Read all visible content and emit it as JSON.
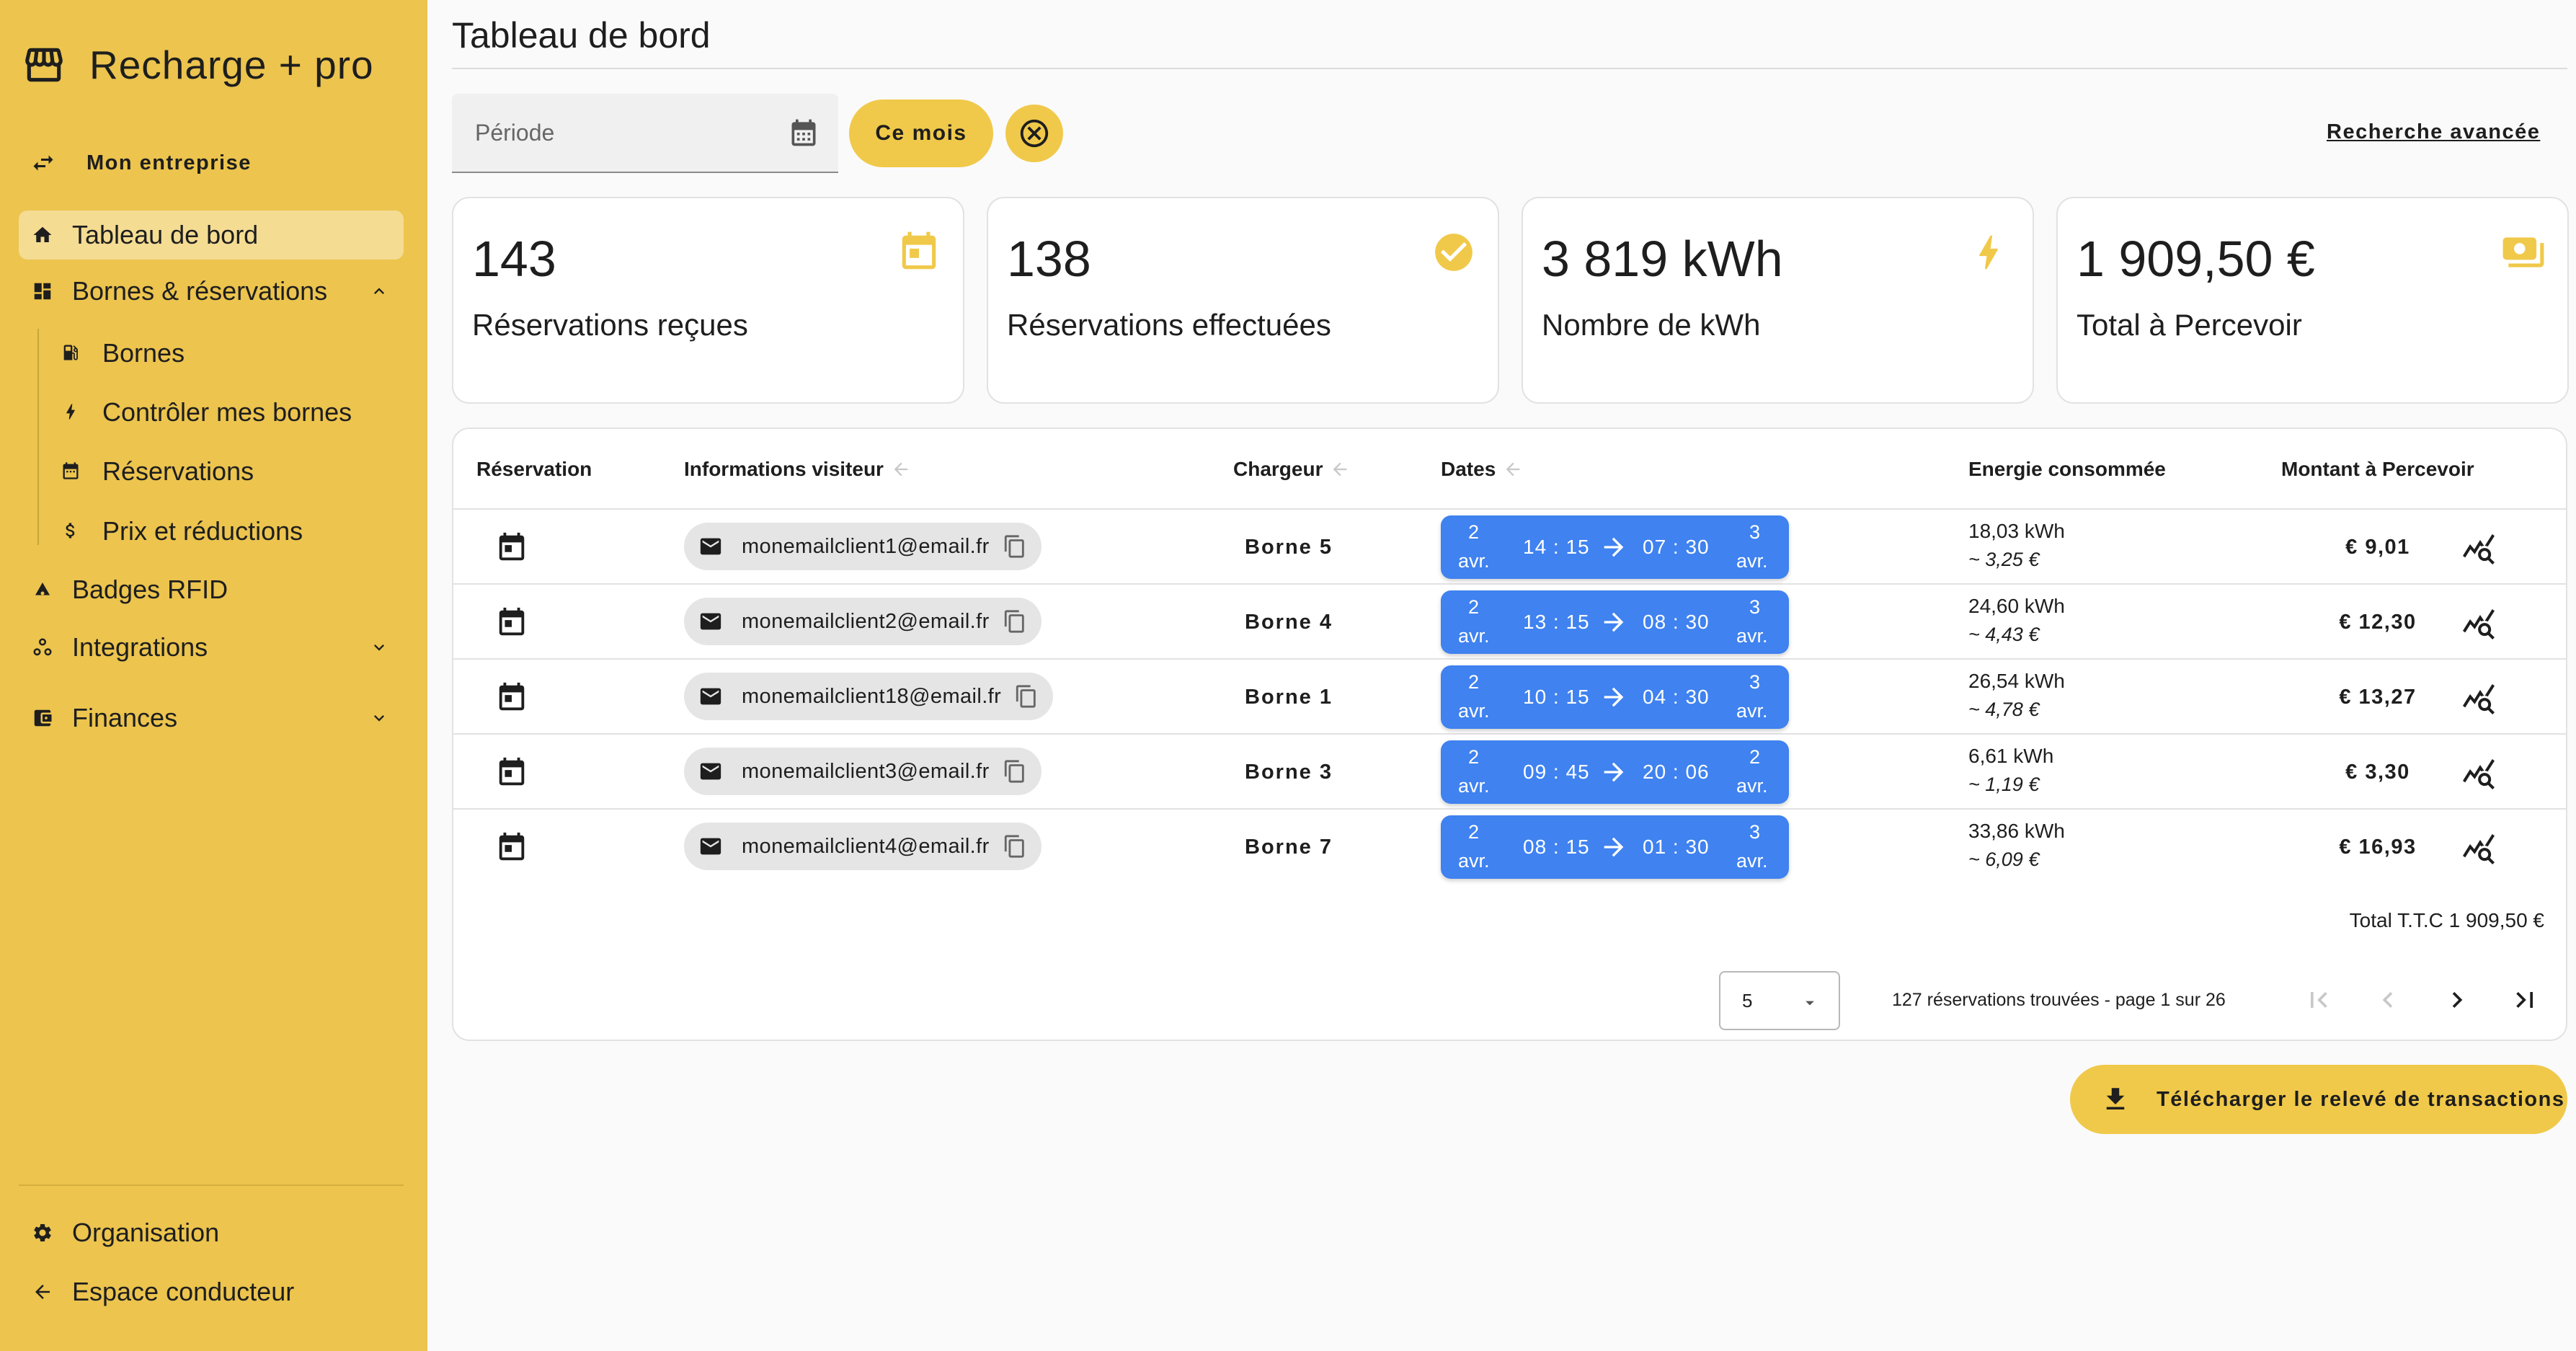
{
  "app": {
    "title": "Recharge + pro"
  },
  "sidebar": {
    "company": "Mon entreprise",
    "items": [
      {
        "label": "Tableau de bord",
        "icon": "home-icon",
        "active": true
      },
      {
        "label": "Bornes & réservations",
        "icon": "dashboard-icon",
        "expanded": true
      },
      {
        "label": "Bornes",
        "icon": "ev-station-icon"
      },
      {
        "label": "Contrôler mes bornes",
        "icon": "bolt-icon"
      },
      {
        "label": "Réservations",
        "icon": "calendar-icon"
      },
      {
        "label": "Prix et réductions",
        "icon": "price-icon"
      },
      {
        "label": "Badges RFID",
        "icon": "rfid-icon"
      },
      {
        "label": "Integrations",
        "icon": "integrations-icon",
        "expanded": false
      },
      {
        "label": "Finances",
        "icon": "wallet-icon",
        "expanded": false
      }
    ],
    "bottom": [
      {
        "label": "Organisation",
        "icon": "gear-icon"
      },
      {
        "label": "Espace conducteur",
        "icon": "arrow-left-icon"
      }
    ]
  },
  "header": {
    "title": "Tableau de bord"
  },
  "filters": {
    "period_placeholder": "Période",
    "month_button": "Ce mois",
    "advanced_search": "Recherche avancée"
  },
  "stats": [
    {
      "value": "143",
      "label": "Réservations reçues",
      "icon": "calendar-today-icon"
    },
    {
      "value": "138",
      "label": "Réservations effectuées",
      "icon": "check-circle-icon"
    },
    {
      "value": "3 819 kWh",
      "label": "Nombre de kWh",
      "icon": "bolt-icon"
    },
    {
      "value": "1 909,50 €",
      "label": "Total à Percevoir",
      "icon": "money-icon"
    }
  ],
  "table": {
    "columns": [
      "Réservation",
      "Informations visiteur",
      "Chargeur",
      "Dates",
      "Energie consommée",
      "Montant à Percevoir"
    ],
    "rows": [
      {
        "email": "monemailclient1@email.fr",
        "charger": "Borne 5",
        "start_day": "2",
        "start_month": "avr.",
        "start_time": "14 : 15",
        "end_time": "07 : 30",
        "end_day": "3",
        "end_month": "avr.",
        "energy": "18,03 kWh",
        "energy_cost": "~ 3,25 €",
        "amount": "€ 9,01"
      },
      {
        "email": "monemailclient2@email.fr",
        "charger": "Borne 4",
        "start_day": "2",
        "start_month": "avr.",
        "start_time": "13 : 15",
        "end_time": "08 : 30",
        "end_day": "3",
        "end_month": "avr.",
        "energy": "24,60 kWh",
        "energy_cost": "~ 4,43 €",
        "amount": "€ 12,30"
      },
      {
        "email": "monemailclient18@email.fr",
        "charger": "Borne 1",
        "start_day": "2",
        "start_month": "avr.",
        "start_time": "10 : 15",
        "end_time": "04 : 30",
        "end_day": "3",
        "end_month": "avr.",
        "energy": "26,54 kWh",
        "energy_cost": "~ 4,78 €",
        "amount": "€ 13,27"
      },
      {
        "email": "monemailclient3@email.fr",
        "charger": "Borne 3",
        "start_day": "2",
        "start_month": "avr.",
        "start_time": "09 : 45",
        "end_time": "20 : 06",
        "end_day": "2",
        "end_month": "avr.",
        "energy": "6,61 kWh",
        "energy_cost": "~ 1,19 €",
        "amount": "€ 3,30"
      },
      {
        "email": "monemailclient4@email.fr",
        "charger": "Borne 7",
        "start_day": "2",
        "start_month": "avr.",
        "start_time": "08 : 15",
        "end_time": "01 : 30",
        "end_day": "3",
        "end_month": "avr.",
        "energy": "33,86 kWh",
        "energy_cost": "~ 6,09 €",
        "amount": "€ 16,93"
      }
    ],
    "total": "Total T.T.C 1 909,50 €"
  },
  "pagination": {
    "page_size": "5",
    "info": "127 réservations trouvées - page 1 sur 26"
  },
  "download_button": "Télécharger le relevé de transactions",
  "colors": {
    "sidebar": "#ecc44e",
    "accent": "#f0c94a",
    "date_pill": "#3f82f0"
  }
}
